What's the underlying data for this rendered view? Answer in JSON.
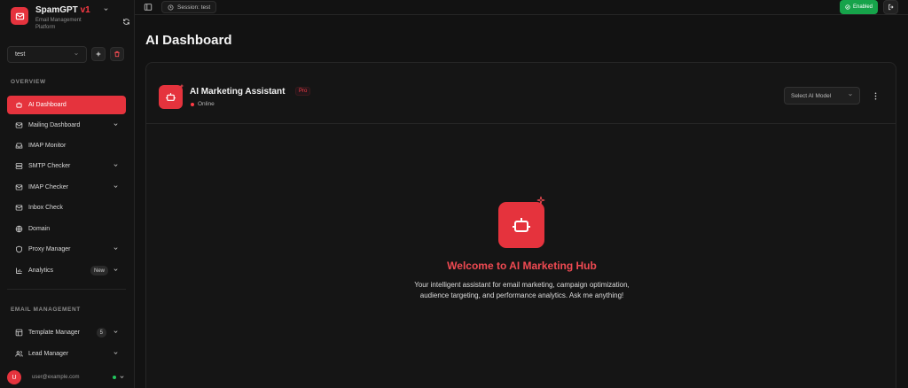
{
  "brand": {
    "name": "SpamGPT",
    "version": "v1",
    "subtitle": "Email Management Platform"
  },
  "workspace": {
    "selected": "test"
  },
  "sidebar": {
    "overview_label": "OVERVIEW",
    "overview_items": [
      {
        "label": "AI Dashboard",
        "icon": "robot-icon",
        "active": true
      },
      {
        "label": "Mailing Dashboard",
        "icon": "mail-icon",
        "chevron": true
      },
      {
        "label": "IMAP Monitor",
        "icon": "inbox-icon"
      },
      {
        "label": "SMTP Checker",
        "icon": "server-icon",
        "chevron": true
      },
      {
        "label": "IMAP Checker",
        "icon": "mail-icon",
        "chevron": true
      },
      {
        "label": "Inbox Check",
        "icon": "mail-check-icon"
      },
      {
        "label": "Domain",
        "icon": "globe-icon"
      },
      {
        "label": "Proxy Manager",
        "icon": "shield-icon",
        "chevron": true
      },
      {
        "label": "Analytics",
        "icon": "bar-chart-icon",
        "badge": "New",
        "chevron": true
      }
    ],
    "email_label": "EMAIL MANAGEMENT",
    "email_items": [
      {
        "label": "Template Manager",
        "icon": "template-icon",
        "badge": "5",
        "chevron": true
      },
      {
        "label": "Lead Manager",
        "icon": "users-icon",
        "chevron": true
      }
    ]
  },
  "user": {
    "initial": "U",
    "email": "user@example.com"
  },
  "topbar": {
    "session": "Session: test",
    "enabled": "Enabled"
  },
  "page": {
    "title": "AI Dashboard"
  },
  "assistant": {
    "title": "AI Marketing Assistant",
    "badge": "Pro",
    "status": "Online",
    "model_placeholder": "Select AI Model"
  },
  "hero": {
    "title": "Welcome to AI Marketing Hub",
    "description": "Your intelligent assistant for email marketing, campaign optimization, audience targeting, and performance analytics. Ask me anything!"
  },
  "colors": {
    "accent": "#e5333d",
    "success": "#16a34a",
    "background": "#121212"
  }
}
